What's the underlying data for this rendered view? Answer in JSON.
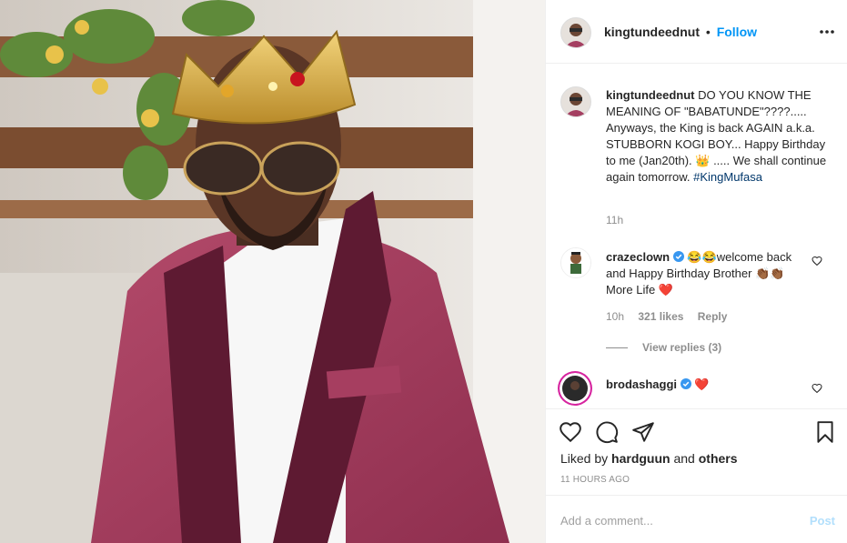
{
  "photo": {
    "alt_icon": "post-photo"
  },
  "header": {
    "username": "kingtundeednut",
    "separator": "•",
    "follow": "Follow",
    "more_icon": "more-dots-icon"
  },
  "caption": {
    "username": "kingtundeednut",
    "text": "DO YOU KNOW THE MEANING OF \"BABATUNDE\"????..... Anyways, the King is back AGAIN a.k.a. STUBBORN KOGI BOY... Happy Birthday to me (Jan20th). 👑 ..... We shall continue again tomorrow.",
    "hashtag": "#KingMufasa",
    "time": "11h"
  },
  "comments": [
    {
      "username": "crazeclown",
      "verified": true,
      "text": "😂😂welcome back and Happy Birthday Brother 👏🏾👏🏾 More Life ❤️",
      "time": "10h",
      "likes": "321 likes",
      "reply": "Reply",
      "view_replies": "View replies (3)"
    },
    {
      "username": "brodashaggi",
      "verified": true,
      "text": "❤️"
    }
  ],
  "actions": {
    "liked_prefix": "Liked by",
    "liked_user": "hardguun",
    "liked_and": "and",
    "liked_others": "others",
    "timestamp": "11 HOURS AGO"
  },
  "add_comment": {
    "placeholder": "Add a comment...",
    "post": "Post"
  },
  "colors": {
    "accent": "#0095f6",
    "heart": "#ed4956",
    "text": "#262626",
    "muted": "#8e8e8e"
  }
}
